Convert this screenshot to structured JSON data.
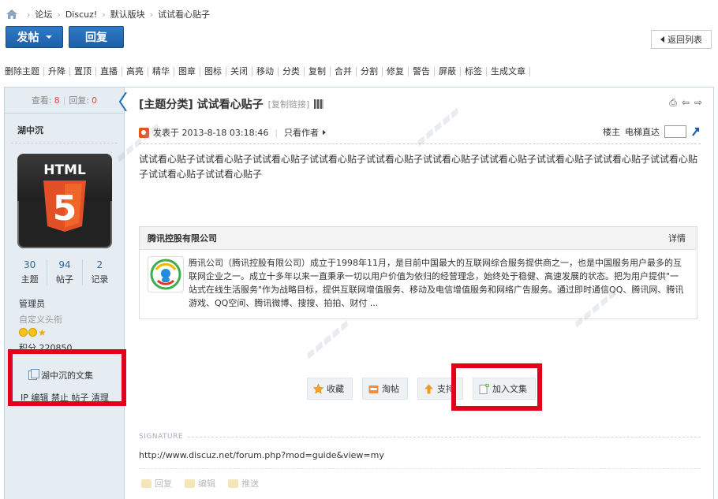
{
  "breadcrumb": [
    "论坛",
    "Discuz!",
    "默认版块",
    "试试看心贴子"
  ],
  "buttons": {
    "post": "发帖",
    "reply": "回复",
    "back": "返回列表"
  },
  "admin_toolbar": [
    "删除主题",
    "升降",
    "置顶",
    "直播",
    "高亮",
    "精华",
    "图章",
    "图标",
    "关闭",
    "移动",
    "分类",
    "复制",
    "合并",
    "分割",
    "修复",
    "警告",
    "屏蔽",
    "标签",
    "生成文章"
  ],
  "sidebar": {
    "views_label": "查看:",
    "views": "8",
    "replies_label": "回复:",
    "replies": "0",
    "username": "湖中沉",
    "avatar_text": "HTML",
    "avatar_digit": "5",
    "stats": [
      {
        "num": "30",
        "label": "主题"
      },
      {
        "num": "94",
        "label": "帖子"
      },
      {
        "num": "2",
        "label": "记录"
      }
    ],
    "group": "管理员",
    "custom_title": "自定义头衔",
    "credit": "积分  220850",
    "collection_link": "湖中沉的文集",
    "ops": [
      "IP",
      "编辑",
      "禁止",
      "帖子",
      "清理"
    ]
  },
  "post": {
    "title": "[主题分类] 试试看心贴子",
    "copy_link": "[复制链接]",
    "posted_at": "发表于 2013-8-18 03:18:46",
    "only_author": "只看作者",
    "floor": "楼主",
    "jump_label": "电梯直达",
    "body": "试试看心贴子试试看心贴子试试看心贴子试试看心贴子试试看心贴子试试看心贴子试试看心贴子试试看心贴子试试看心贴子试试看心贴子试试看心贴子试试看心贴子",
    "card": {
      "company": "腾讯控股有限公司",
      "detail": "详情",
      "description": "腾讯公司（腾讯控股有限公司）成立于1998年11月，是目前中国最大的互联网综合服务提供商之一，也是中国服务用户最多的互联网企业之一。成立十多年以来一直秉承一切以用户价值为依归的经营理念，始终处于稳健、高速发展的状态。把为用户提供\"一站式在线生活服务\"作为战略目标，提供互联网增值服务、移动及电信增值服务和网络广告服务。通过即时通信QQ、腾讯网、腾讯游戏、QQ空间、腾讯微博、搜搜、拍拍、财付 ..."
    },
    "actions": [
      "收藏",
      "淘帖",
      "支持",
      "加入文集"
    ],
    "signature_label": "SIGNATURE",
    "signature": "http://www.discuz.net/forum.php?mod=guide&view=my",
    "post_ops": [
      "回复",
      "编辑",
      "推送"
    ]
  },
  "colors": {
    "primary_button": "#1d5fa8",
    "sidebar_bg": "#e5edf2",
    "border": "#c2d5e3",
    "highlight": "#e5001a"
  }
}
